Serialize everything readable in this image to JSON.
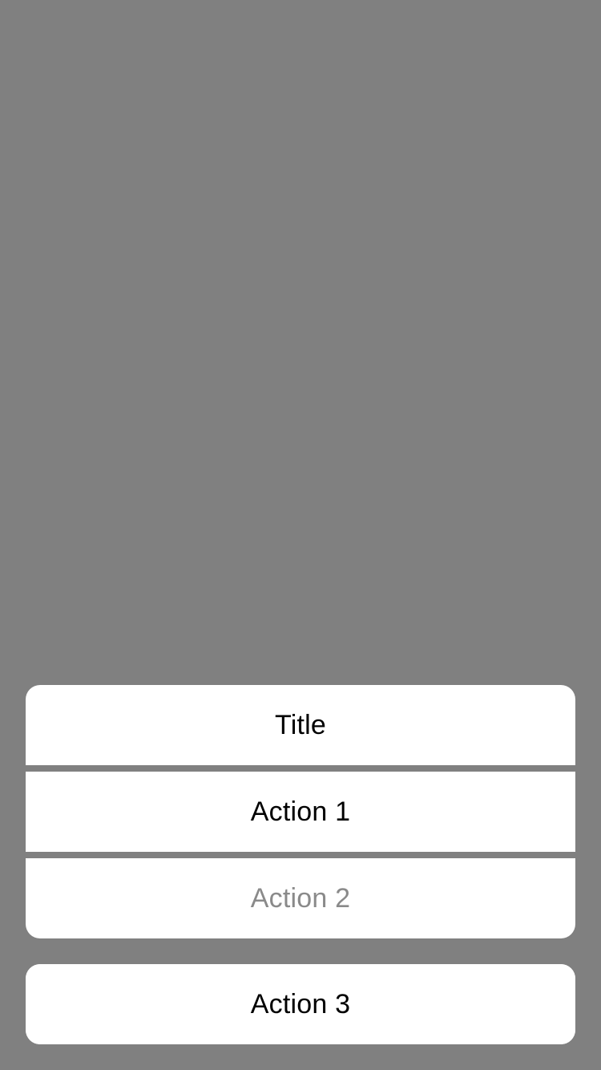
{
  "action_sheet": {
    "title": "Title",
    "actions": [
      {
        "label": "Action 1",
        "enabled": true
      },
      {
        "label": "Action 2",
        "enabled": false
      }
    ],
    "cancel": {
      "label": "Action 3"
    }
  },
  "colors": {
    "backdrop": "#808080",
    "sheet_background": "#ffffff",
    "text_primary": "#000000",
    "text_disabled": "#8a8a8a"
  }
}
